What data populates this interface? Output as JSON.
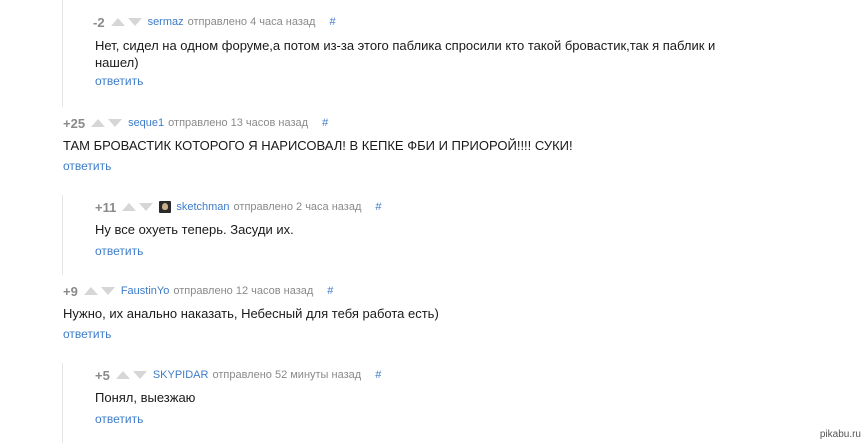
{
  "comments": [
    {
      "rating": "-2",
      "author": "sermaz",
      "posted": "отправлено 4 часа назад",
      "hash": "#",
      "text": "Нет, сидел на одном форуме,а потом из-за этого паблика спросили кто такой бровастик,так я паблик и нашел)",
      "reply": "ответить"
    },
    {
      "rating": "+25",
      "author": "seque1",
      "posted": "отправлено 13 часов назад",
      "hash": "#",
      "text": "ТАМ БРОВАСТИК КОТОРОГО Я НАРИСОВАЛ! В КЕПКЕ ФБИ И ПРИОРОЙ!!!! СУКИ!",
      "reply": "ответить"
    },
    {
      "rating": "+11",
      "author": "sketchman",
      "posted": "отправлено 2 часа назад",
      "hash": "#",
      "text": "Ну все охуеть теперь. Засуди их.",
      "reply": "ответить"
    },
    {
      "rating": "+9",
      "author": "FaustinYo",
      "posted": "отправлено 12 часов назад",
      "hash": "#",
      "text": "Нужно, их анально наказать, Небесный для тебя работа есть)",
      "reply": "ответить"
    },
    {
      "rating": "+5",
      "author": "SKYPIDAR",
      "posted": "отправлено 52 минуты назад",
      "hash": "#",
      "text": "Понял, выезжаю",
      "reply": "ответить"
    }
  ],
  "watermark": "pikabu.ru",
  "colors": {
    "link": "#3d7cc9",
    "muted": "#8a8a8a",
    "vote_arrow": "#d6d6d6",
    "thread_line": "#e4e4e4"
  }
}
